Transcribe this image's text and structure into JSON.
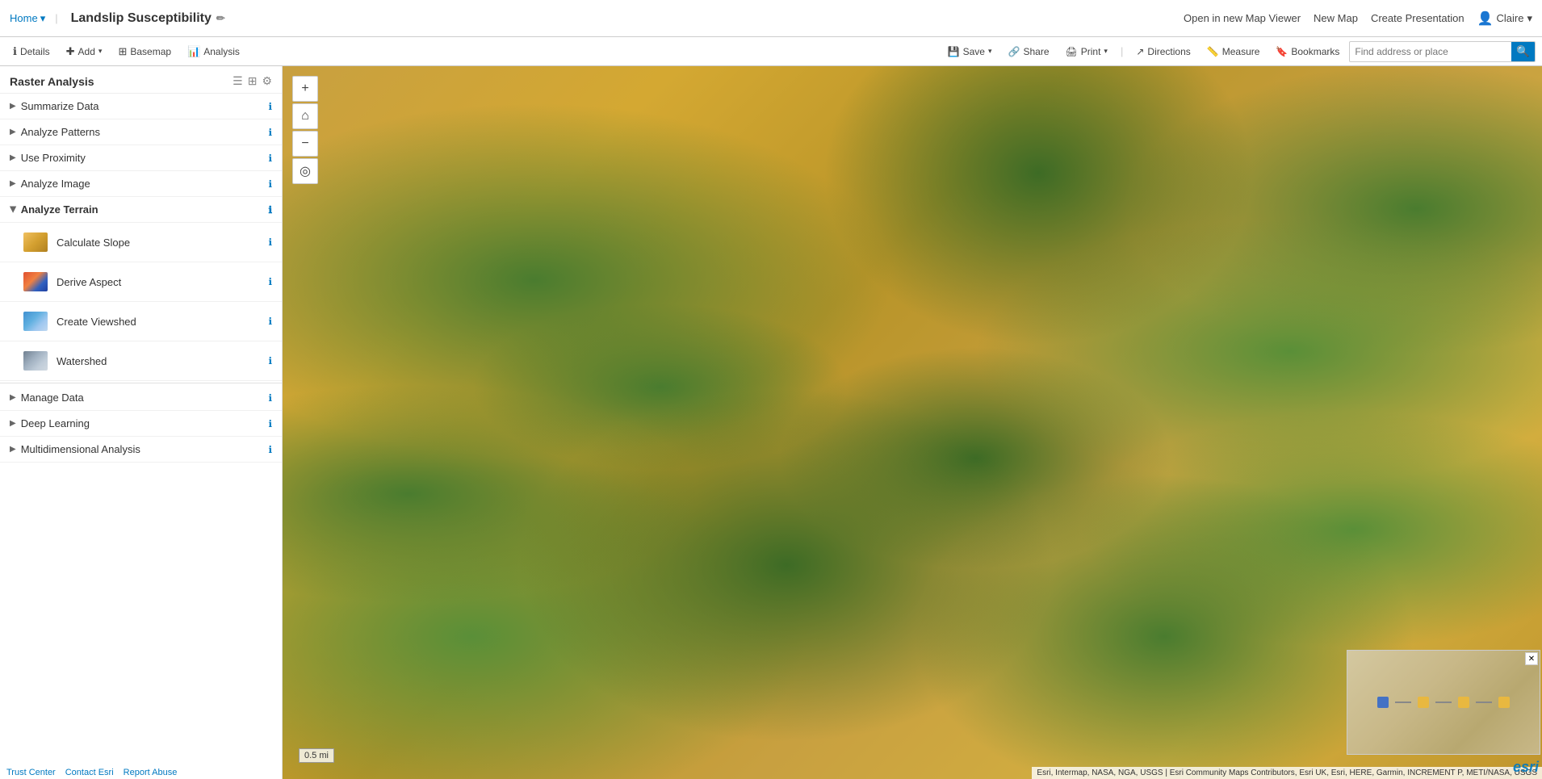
{
  "app": {
    "home_label": "Home",
    "map_title": "Landslip Susceptibility",
    "open_new_viewer": "Open in new Map Viewer",
    "new_map": "New Map",
    "create_presentation": "Create Presentation",
    "user": "Claire"
  },
  "toolbar": {
    "details_label": "Details",
    "add_label": "Add",
    "basemap_label": "Basemap",
    "analysis_label": "Analysis",
    "save_label": "Save",
    "share_label": "Share",
    "print_label": "Print",
    "directions_label": "Directions",
    "measure_label": "Measure",
    "bookmarks_label": "Bookmarks",
    "search_placeholder": "Find address or place"
  },
  "sidebar": {
    "title": "Raster Analysis",
    "sections": [
      {
        "id": "summarize-data",
        "label": "Summarize Data",
        "expanded": false
      },
      {
        "id": "analyze-patterns",
        "label": "Analyze Patterns",
        "expanded": false
      },
      {
        "id": "use-proximity",
        "label": "Use Proximity",
        "expanded": false
      },
      {
        "id": "analyze-image",
        "label": "Analyze Image",
        "expanded": false
      },
      {
        "id": "analyze-terrain",
        "label": "Analyze Terrain",
        "expanded": true
      },
      {
        "id": "manage-data",
        "label": "Manage Data",
        "expanded": false
      },
      {
        "id": "deep-learning",
        "label": "Deep Learning",
        "expanded": false
      },
      {
        "id": "multidimensional-analysis",
        "label": "Multidimensional Analysis",
        "expanded": false
      }
    ],
    "terrain_sub_items": [
      {
        "id": "calculate-slope",
        "label": "Calculate Slope",
        "icon_type": "slope"
      },
      {
        "id": "derive-aspect",
        "label": "Derive Aspect",
        "icon_type": "aspect"
      },
      {
        "id": "create-viewshed",
        "label": "Create Viewshed",
        "icon_type": "viewshed"
      },
      {
        "id": "watershed",
        "label": "Watershed",
        "icon_type": "watershed"
      }
    ]
  },
  "map_controls": {
    "zoom_in": "+",
    "home": "⌂",
    "zoom_out": "−",
    "locate": "◎"
  },
  "map": {
    "scale_label": "0.5 mi",
    "attribution": "Esri, Intermap, NASA, NGA, USGS | Esri Community Maps Contributors, Esri UK, Esri, HERE, Garmin, INCREMENT P, METI/NASA, USGS"
  },
  "footer": {
    "trust_center": "Trust Center",
    "contact_esri": "Contact Esri",
    "report_abuse": "Report Abuse"
  }
}
